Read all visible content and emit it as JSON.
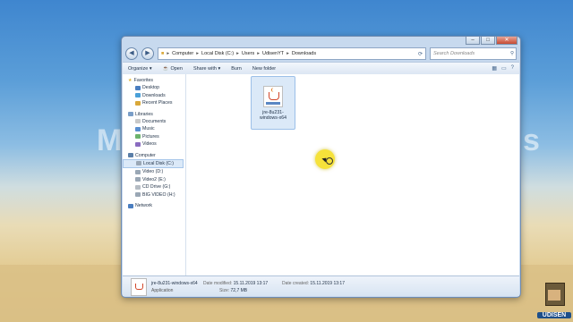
{
  "background": {
    "left_text": "M",
    "right_text": "s"
  },
  "window": {
    "controls": {
      "minimize": "–",
      "maximize": "□",
      "close": "✕"
    },
    "address": {
      "parts": [
        "Computer",
        "Local Disk (C:)",
        "Users",
        "UdisenYT",
        "Downloads"
      ],
      "search_placeholder": "Search Downloads"
    },
    "toolbar": {
      "organize": "Organize ▾",
      "open": "Open",
      "share_with": "Share with ▾",
      "burn": "Burn",
      "new_folder": "New folder"
    },
    "nav": {
      "favorites": {
        "label": "Favorites",
        "items": [
          "Desktop",
          "Downloads",
          "Recent Places"
        ]
      },
      "libraries": {
        "label": "Libraries",
        "items": [
          "Documents",
          "Music",
          "Pictures",
          "Videos"
        ]
      },
      "computer": {
        "label": "Computer",
        "items": [
          "Local Disk (C:)",
          "Video (D:)",
          "Video2 (E:)",
          "CD Drive (G:)",
          "BIG VIDEO (H:)"
        ]
      },
      "network": {
        "label": "Network"
      }
    },
    "file": {
      "name": "jre-8u231-windows-x64"
    },
    "details": {
      "name": "jre-8u231-windows-x64",
      "type": "Application",
      "modified_label": "Date modified:",
      "modified_value": "15.11.2019 13:17",
      "size_label": "Size:",
      "size_value": "72,7 MB",
      "created_label": "Date created:",
      "created_value": "15.11.2019 13:17"
    }
  },
  "logo": {
    "text": "UDISEN"
  },
  "colors": {
    "selection": "#dbe9f8",
    "window_frame": "#c7d9ee",
    "cursor_highlight": "#f6e23a"
  }
}
